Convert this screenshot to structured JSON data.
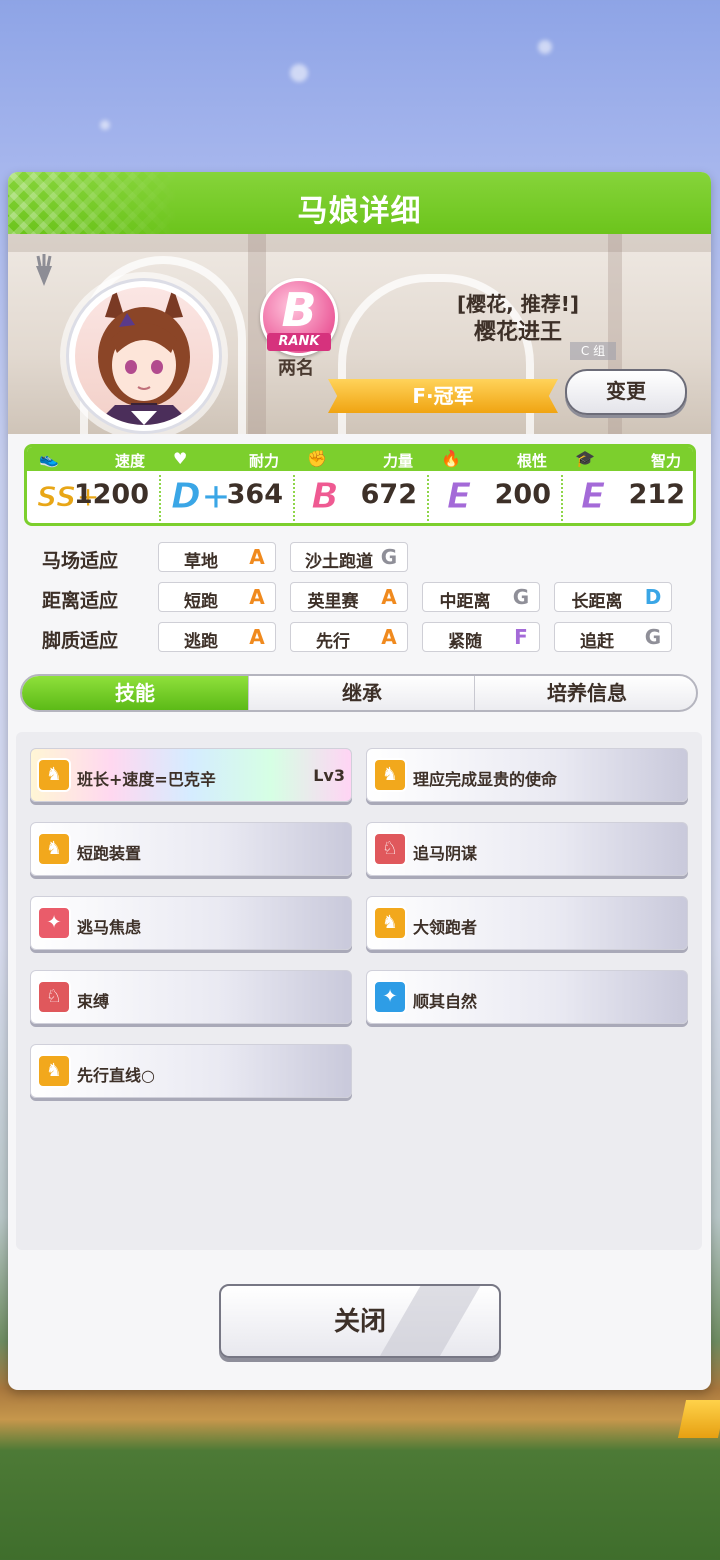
{
  "dialog": {
    "title": "马娘详细"
  },
  "profile": {
    "rank_letter": "B",
    "rank_ribbon": "RANK",
    "rank_name": "两名",
    "epithet": "[樱花, 推荐!]",
    "name": "樱花进王",
    "group": "C 组",
    "title": "F·冠军",
    "change_button": "变更"
  },
  "stats": [
    {
      "icon": "shoe-icon",
      "label": "速度",
      "grade": "SS+",
      "value": "1200",
      "grade_color": "#e8a617"
    },
    {
      "icon": "heart-icon",
      "label": "耐力",
      "grade": "D+",
      "value": "364",
      "grade_color": "#3aa6e6"
    },
    {
      "icon": "muscle-icon",
      "label": "力量",
      "grade": "B",
      "value": "672",
      "grade_color": "#ef5a92"
    },
    {
      "icon": "flame-icon",
      "label": "根性",
      "grade": "E",
      "value": "200",
      "grade_color": "#a46ad8"
    },
    {
      "icon": "graduation-cap-icon",
      "label": "智力",
      "grade": "E",
      "value": "212",
      "grade_color": "#a46ad8"
    }
  ],
  "aptitude": {
    "track": {
      "label": "马场适应",
      "items": [
        {
          "name": "草地",
          "grade": "A"
        },
        {
          "name": "沙土跑道",
          "grade": "G"
        }
      ]
    },
    "distance": {
      "label": "距离适应",
      "items": [
        {
          "name": "短跑",
          "grade": "A"
        },
        {
          "name": "英里赛",
          "grade": "A"
        },
        {
          "name": "中距离",
          "grade": "G"
        },
        {
          "name": "长距离",
          "grade": "D"
        }
      ]
    },
    "style": {
      "label": "脚质适应",
      "items": [
        {
          "name": "逃跑",
          "grade": "A"
        },
        {
          "name": "先行",
          "grade": "A"
        },
        {
          "name": "紧随",
          "grade": "F"
        },
        {
          "name": "追赶",
          "grade": "G"
        }
      ]
    },
    "grade_colors": {
      "A": "#f08a1e",
      "D": "#3aa6e6",
      "F": "#a46ad8",
      "G": "#8f8f98"
    }
  },
  "tabs": [
    {
      "label": "技能",
      "active": true
    },
    {
      "label": "继承",
      "active": false
    },
    {
      "label": "培养信息",
      "active": false
    }
  ],
  "skills": [
    {
      "name": "班长+速度=巴克辛",
      "level": "Lv3",
      "icon": "running-horse-icon",
      "icon_color": "#f2a81c",
      "rainbow": true
    },
    {
      "name": "理应完成显贵的使命",
      "level": "",
      "icon": "running-horse-icon",
      "icon_color": "#f2a81c",
      "rainbow": false
    },
    {
      "name": "短跑装置",
      "level": "",
      "icon": "running-horse-icon",
      "icon_color": "#f2a81c",
      "rainbow": false
    },
    {
      "name": "追马阴谋",
      "level": "",
      "icon": "horse-head-icon",
      "icon_color": "#e0585c",
      "rainbow": false
    },
    {
      "name": "逃马焦虑",
      "level": "",
      "icon": "sparkle-icon",
      "icon_color": "#ea5c6a",
      "rainbow": false
    },
    {
      "name": "大领跑者",
      "level": "",
      "icon": "running-horse-icon",
      "icon_color": "#f2a81c",
      "rainbow": false
    },
    {
      "name": "束缚",
      "level": "",
      "icon": "horse-icon",
      "icon_color": "#e0585c",
      "rainbow": false
    },
    {
      "name": "顺其自然",
      "level": "",
      "icon": "sparkle-icon",
      "icon_color": "#2e9de6",
      "rainbow": false
    },
    {
      "name": "先行直线○",
      "level": "",
      "icon": "running-horse-icon",
      "icon_color": "#f2a81c",
      "rainbow": false
    }
  ],
  "close_button": "关闭"
}
